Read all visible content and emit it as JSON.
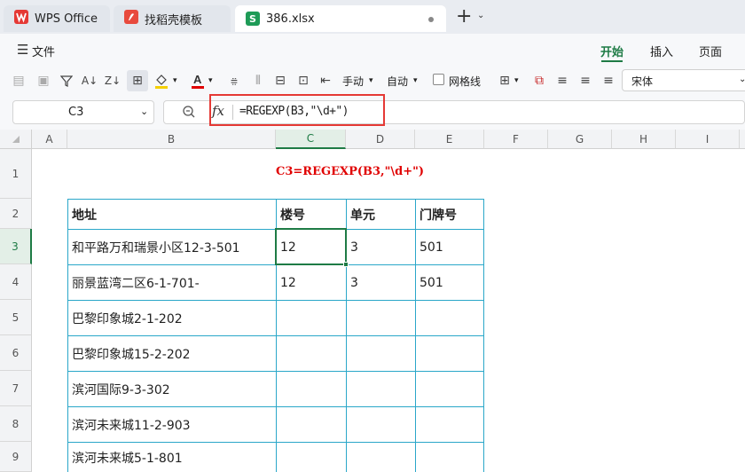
{
  "tabs": [
    {
      "label": "WPS Office",
      "icon": "wps-logo-icon"
    },
    {
      "label": "找稻壳模板",
      "icon": "docer-logo-icon"
    },
    {
      "label": "386.xlsx",
      "icon": "spreadsheet-icon",
      "logo_letter": "S"
    }
  ],
  "menu": {
    "file_label": "文件",
    "tabs": [
      "开始",
      "插入",
      "页面"
    ]
  },
  "toolbar": {
    "manual_label": "手动",
    "auto_label": "自动",
    "gridlines_label": "网格线",
    "font_name": "宋体"
  },
  "formula_bar": {
    "name_box": "C3",
    "fx_label": "fx",
    "formula": "=REGEXP(B3,\"\\d+\")"
  },
  "columns": [
    "A",
    "B",
    "C",
    "D",
    "E",
    "F",
    "G",
    "H",
    "I"
  ],
  "rows": [
    "1",
    "2",
    "3",
    "4",
    "5",
    "6",
    "7",
    "8",
    "9"
  ],
  "title_formula": "C3=REGEXP(B3,\"\\d+\")",
  "table": {
    "headers": [
      "地址",
      "楼号",
      "单元",
      "门牌号"
    ],
    "rows": [
      [
        "和平路万和瑞景小区12-3-501",
        "12",
        "3",
        "501"
      ],
      [
        "丽景蓝湾二区6-1-701-",
        "12",
        "3",
        "501"
      ],
      [
        "巴黎印象城2-1-202",
        "",
        "",
        ""
      ],
      [
        "巴黎印象城15-2-202",
        "",
        "",
        ""
      ],
      [
        "滨河国际9-3-302",
        "",
        "",
        ""
      ],
      [
        "滨河未来城11-2-903",
        "",
        "",
        ""
      ],
      [
        "滨河未来城5-1-801",
        "",
        "",
        ""
      ]
    ]
  },
  "colors": {
    "accent_green": "#1e7b45",
    "formula_red": "#e00000",
    "table_border": "#2aa7c9",
    "highlight_box": "#e53935"
  }
}
